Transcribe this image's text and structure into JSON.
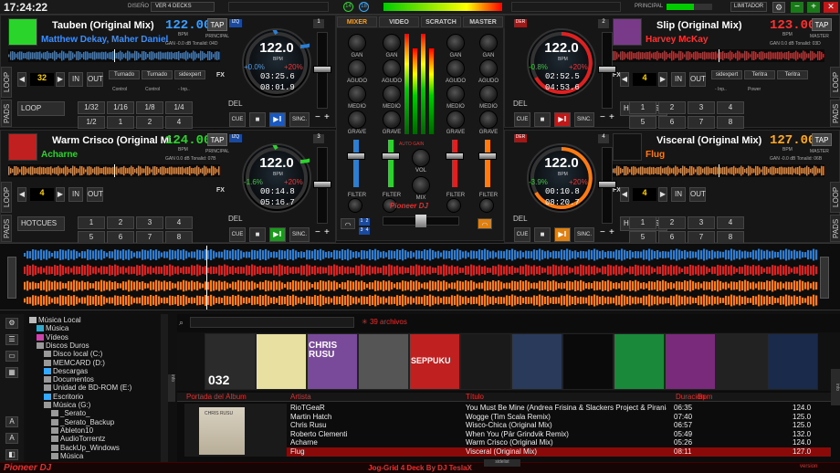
{
  "app": {
    "clock": "17:24:22",
    "skin_label": "DISEÑO",
    "skin_value": "VER 4 DECKS",
    "principal": "PRINCIPAL",
    "limitador": "LIMITADOR",
    "footer_center": "Jog-Grid 4 Deck By DJ TeslaX",
    "sidebar_label": "sidelist",
    "logo": "Pioneer DJ",
    "mixer_logo": "Pioneer DJ",
    "auto_gain": "AUTO GAIN",
    "version_tag": "version"
  },
  "mixer_tabs": [
    "MIXER",
    "VIDEO",
    "SCRATCH",
    "MASTER"
  ],
  "mixer": {
    "row_labels": [
      "GAN",
      "AGUDO",
      "MEDIO",
      "GRAVE"
    ],
    "filter": "FILTER",
    "vol": "VOL",
    "mix": "MIX",
    "channels": [
      "1",
      "2",
      "3",
      "4"
    ],
    "top_counts": [
      "14",
      "18"
    ]
  },
  "decks": [
    {
      "num": "1",
      "title": "Tauben (Original Mix)",
      "artist": "Matthew Dekay, Maher Daniel",
      "bpm": "122.00",
      "bpm_unit": "BPM",
      "tap": "TAP",
      "mode": "PRINCIPAL",
      "gain_text": "GAN -0.0 dB  Tonalid: 04D",
      "loop_label": "LOOP",
      "loop_value": "32",
      "in": "IN",
      "out": "OUT",
      "fx": "FX",
      "pads": "PADS",
      "pad_mode": "LOOP",
      "jog_bpm": "122.0",
      "jog_pitch": "+0.0%",
      "jog_range": "+20%",
      "time1": "03:25.6",
      "time2": "08:01.9",
      "del": "DEL",
      "cue": "CUE",
      "sync": "SINC.",
      "fx_slots": [
        "Turnado",
        "Turnado",
        "sidexpert"
      ],
      "fx_params": [
        "Control",
        "Control",
        "- Inp.."
      ],
      "pads_values": [
        "1/32",
        "1/16",
        "1/8",
        "1/4",
        "1/2",
        "1",
        "2",
        "4"
      ],
      "tag": "IZQ"
    },
    {
      "num": "2",
      "title": "Slip (Original Mix)",
      "artist": "Harvey McKay",
      "bpm": "123.00",
      "bpm_unit": "BPM",
      "tap": "TAP",
      "mode": "MASTER",
      "gain_text": "GAN 0.0 dB  Tonalid: 03D",
      "loop_label": "LOOP",
      "loop_value": "4",
      "in": "IN",
      "out": "OUT",
      "fx": "FX",
      "pads": "PADS",
      "pad_mode": "HOTCUES",
      "jog_bpm": "122.0",
      "jog_pitch": "-0.8%",
      "jog_range": "+20%",
      "time1": "02:52.5",
      "time2": "04:53.6",
      "del": "DEL",
      "cue": "CUE",
      "sync": "SINC.",
      "fx_slots": [
        "sidexpert",
        "Teritra",
        "Teritra"
      ],
      "fx_params": [
        "- Inp..",
        "Power",
        ""
      ],
      "pads_values": [
        "1",
        "2",
        "3",
        "4",
        "5",
        "6",
        "7",
        "8"
      ],
      "tag": "DER"
    },
    {
      "num": "3",
      "title": "Warm Crisco (Original Mix)",
      "artist": "Acharne",
      "bpm": "124.00",
      "bpm_unit": "BPM",
      "tap": "TAP",
      "mode": "PRINCIPAL",
      "gain_text": "GAN 0.0 dB  Tonalid: 07B",
      "loop_label": "LOOP",
      "loop_value": "4",
      "in": "IN",
      "out": "OUT",
      "fx": "FX",
      "pads": "PADS",
      "pad_mode": "HOTCUES",
      "jog_bpm": "122.0",
      "jog_pitch": "-1.6%",
      "jog_range": "+20%",
      "time1": "00:14.8",
      "time2": "05:16.7",
      "del": "DEL",
      "cue": "CUE",
      "sync": "SINC.",
      "fx_slots": [],
      "fx_params": [],
      "pads_values": [
        "1",
        "2",
        "3",
        "4",
        "5",
        "6",
        "7",
        "8"
      ],
      "tag": "IZQ"
    },
    {
      "num": "4",
      "title": "Visceral (Original Mix)",
      "artist": "Flug",
      "bpm": "127.00",
      "bpm_unit": "BPM",
      "tap": "TAP",
      "mode": "MASTER",
      "gain_text": "GAN -0.0 dB  Tonalid: 06B",
      "loop_label": "LOOP",
      "loop_value": "4",
      "in": "IN",
      "out": "OUT",
      "fx": "FX",
      "pads": "PADS",
      "pad_mode": "HOTCUES",
      "jog_bpm": "122.0",
      "jog_pitch": "-3.9%",
      "jog_range": "+20%",
      "time1": "00:10.8",
      "time2": "08:20.7",
      "del": "DEL",
      "cue": "CUE",
      "sync": "SINC.",
      "fx_slots": [],
      "fx_params": [],
      "pads_values": [
        "1",
        "2",
        "3",
        "4",
        "5",
        "6",
        "7",
        "8"
      ],
      "tag": "DER"
    }
  ],
  "browser": {
    "search_placeholder": "",
    "file_count": "39 archivos",
    "headers": [
      "Portada del Álbum",
      "Artista",
      "Título",
      "Duración",
      "Bpm"
    ],
    "tree": [
      {
        "label": "Música Local",
        "level": 0,
        "color": "#bbb"
      },
      {
        "label": "Música",
        "level": 1,
        "color": "#3ac"
      },
      {
        "label": "Vídeos",
        "level": 1,
        "color": "#c4a"
      },
      {
        "label": "Discos Duros",
        "level": 1,
        "color": "#999"
      },
      {
        "label": "Disco local (C:)",
        "level": 2,
        "color": "#999"
      },
      {
        "label": "MEMCARD (D:)",
        "level": 2,
        "color": "#999"
      },
      {
        "label": "Descargas",
        "level": 2,
        "color": "#3af"
      },
      {
        "label": "Documentos",
        "level": 2,
        "color": "#999"
      },
      {
        "label": "Unidad de BD-ROM (E:)",
        "level": 2,
        "color": "#999"
      },
      {
        "label": "Escritorio",
        "level": 2,
        "color": "#3af"
      },
      {
        "label": "Música (G:)",
        "level": 2,
        "color": "#999"
      },
      {
        "label": "_Serato_",
        "level": 3,
        "color": "#999"
      },
      {
        "label": "_Serato_Backup",
        "level": 3,
        "color": "#999"
      },
      {
        "label": "Ableton10",
        "level": 3,
        "color": "#999"
      },
      {
        "label": "AudioTorrentz",
        "level": 3,
        "color": "#999"
      },
      {
        "label": "BackUp_Windows",
        "level": 3,
        "color": "#999"
      },
      {
        "label": "Música",
        "level": 3,
        "color": "#999"
      }
    ],
    "rows": [
      {
        "artist": "RioTGeaR",
        "title": "You Must Be Mine (Andrea Frisina & Slackers Project & Pirania Remix)",
        "duration": "06:35",
        "bpm": "124.0"
      },
      {
        "artist": "Martin Hatch",
        "title": "Wogge (Tim Scala Remix)",
        "duration": "07:40",
        "bpm": "125.0"
      },
      {
        "artist": "Chris Rusu",
        "title": "Wisco-Chica (Original Mix)",
        "duration": "06:57",
        "bpm": "125.0"
      },
      {
        "artist": "Roberto Clementi",
        "title": "When You (Pär Grindvik Remix)",
        "duration": "05:49",
        "bpm": "132.0"
      },
      {
        "artist": "Acharne",
        "title": "Warm Crisco (Original Mix)",
        "duration": "05:26",
        "bpm": "124.0"
      },
      {
        "artist": "Flug",
        "title": "Visceral (Original Mix)",
        "duration": "08:11",
        "bpm": "127.0"
      }
    ],
    "album_art_text": "CHRIS RUSU",
    "cover_labels": [
      "032",
      "CHRIS RUSU",
      "SEPPUKU"
    ]
  },
  "colors": {
    "deck1": "#2a7fd4",
    "deck2": "#e02020",
    "deck3": "#ff7a10",
    "deck4": "#ff7a10",
    "accent_green": "#2bd42b",
    "mixer_tab_orange": "#f0a030"
  }
}
